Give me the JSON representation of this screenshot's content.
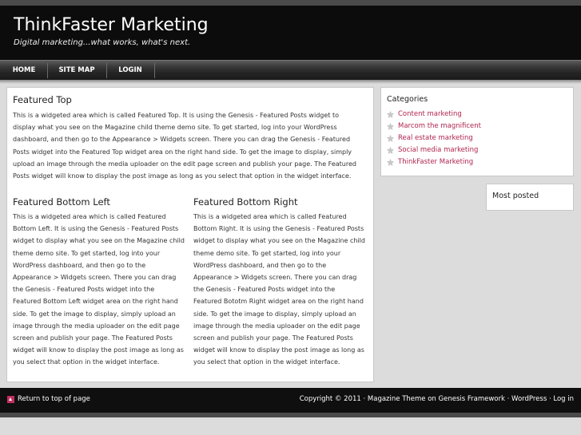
{
  "header": {
    "title": "ThinkFaster Marketing",
    "description": "Digital marketing...what works, what's next."
  },
  "nav": {
    "items": [
      {
        "label": "HOME"
      },
      {
        "label": "SITE MAP"
      },
      {
        "label": "LOGIN"
      }
    ]
  },
  "main": {
    "featured_top": {
      "title": "Featured Top",
      "lines": [
        "This is a widgeted area which is called Featured Top. It is using the Genesis - Featured Posts widget to",
        "display what you see on the Magazine child theme demo site. To get started, log into your WordPress",
        "dashboard, and then go to the Appearance > Widgets screen. There you can drag the Genesis - Featured",
        "Posts widget into the Featured Top widget area on the right hand side. To get the image to display, simply",
        "upload an image through the media uploader on the edit page screen and publish your page. The Featured",
        "Posts widget will know to display the post image as long as you select that option in the widget interface."
      ]
    },
    "featured_bottom_left": {
      "title": "Featured Bottom Left",
      "lines": [
        "This is a widgeted area which is called Featured",
        "Bottom Left. It is using the Genesis - Featured Posts",
        "widget to display what you see on the Magazine child",
        "theme demo site. To get started, log into your",
        "WordPress dashboard, and then go to the",
        "Appearance > Widgets screen. There you can drag",
        "the Genesis - Featured Posts widget into the",
        "Featured Bottom Left widget area on the right hand",
        "side. To get the image to display, simply upload an",
        "image through the media uploader on the edit page",
        "screen and publish your page. The Featured Posts",
        "widget will know to display the post image as long as",
        "you select that option in the widget interface."
      ]
    },
    "featured_bottom_right": {
      "title": "Featured Bottom Right",
      "lines": [
        "This is a widgeted area which is called Featured",
        "Bottom Right. It is using the Genesis - Featured Posts",
        "widget to display what you see on the Magazine child",
        "theme demo site. To get started, log into your",
        "WordPress dashboard, and then go to the",
        "Appearance > Widgets screen. There you can drag",
        "the Genesis - Featured Posts widget into the",
        "Featured Bototm Right widget area on the right hand",
        "side. To get the image to display, simply upload an",
        "image through the media uploader on the edit page",
        "screen and publish your page. The Featured Posts",
        "widget will know to display the post image as long as",
        "you select that option in the widget interface."
      ]
    }
  },
  "sidebar": {
    "categories": {
      "title": "Categories",
      "items": [
        {
          "label": "Content marketing"
        },
        {
          "label": "Marcom the magnificent"
        },
        {
          "label": "Real estate marketing"
        },
        {
          "label": "Social media marketing"
        },
        {
          "label": "ThinkFaster Marketing"
        }
      ]
    },
    "most_posted": {
      "title": "Most posted"
    }
  },
  "footer": {
    "back_to_top": "Return to top of page",
    "copyright": "Copyright © 2011 · Magazine Theme on Genesis Framework · ",
    "wordpress": "WordPress",
    "sep": " · ",
    "login": "Log in"
  },
  "colors": {
    "link": "#b0244f",
    "header_bg": "#0c0c0c",
    "page_bg": "#dcdcdc"
  },
  "icons": {
    "category_bullet": "star-icon",
    "back_to_top": "arrow-up-icon"
  }
}
